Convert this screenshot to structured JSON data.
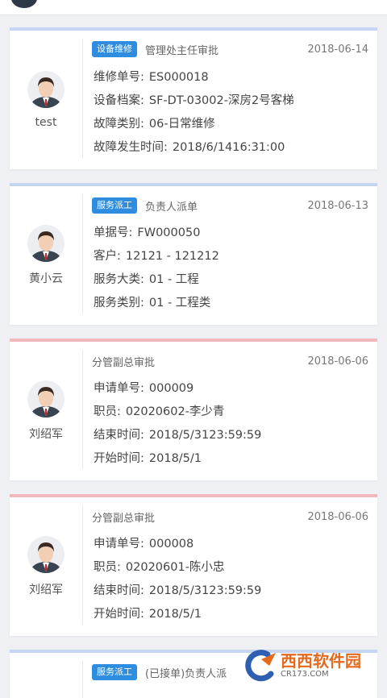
{
  "cards": [
    {
      "stripe_color": "#c6d6f2",
      "avatar_name": "test",
      "tag": "设备维修",
      "title": "管理处主任审批",
      "date": "2018-06-14",
      "rows": [
        {
          "label": "维修单号:",
          "value": "ES000018"
        },
        {
          "label": "设备档案:",
          "value": "SF-DT-03002-深房2号客梯"
        },
        {
          "label": "故障类别:",
          "value": "06-日常维修"
        },
        {
          "label": "故障发生时间:",
          "value": "2018/6/1416:31:00"
        }
      ]
    },
    {
      "stripe_color": "#c6d6f2",
      "avatar_name": "黄小云",
      "tag": "服务派工",
      "title": "负责人派单",
      "date": "2018-06-13",
      "rows": [
        {
          "label": "单据号:",
          "value": "FW000050"
        },
        {
          "label": "客户:",
          "value": "12121 - 121212"
        },
        {
          "label": "服务大类:",
          "value": "01 - 工程"
        },
        {
          "label": "服务类别:",
          "value": "01 - 工程类"
        }
      ]
    },
    {
      "stripe_color": "#f1b9bd",
      "avatar_name": "刘绍军",
      "tag": "",
      "title": "分管副总审批",
      "date": "2018-06-06",
      "rows": [
        {
          "label": "申请单号:",
          "value": "000009"
        },
        {
          "label": "职员:",
          "value": "02020602-李少青"
        },
        {
          "label": "结束时间:",
          "value": "2018/5/3123:59:59"
        },
        {
          "label": "开始时间:",
          "value": "2018/5/1"
        }
      ]
    },
    {
      "stripe_color": "#f1b9bd",
      "avatar_name": "刘绍军",
      "tag": "",
      "title": "分管副总审批",
      "date": "2018-06-06",
      "rows": [
        {
          "label": "申请单号:",
          "value": "000008"
        },
        {
          "label": "职员:",
          "value": "02020601-陈小忠"
        },
        {
          "label": "结束时间:",
          "value": "2018/5/3123:59:59"
        },
        {
          "label": "开始时间:",
          "value": "2018/5/1"
        }
      ]
    },
    {
      "stripe_color": "#c6d6f2",
      "avatar_name": "",
      "tag": "服务派工",
      "title": "(已接单)负责人派",
      "date": "",
      "rows": []
    }
  ],
  "watermark": {
    "main": "西西软件园",
    "sub": "CR173.COM"
  }
}
